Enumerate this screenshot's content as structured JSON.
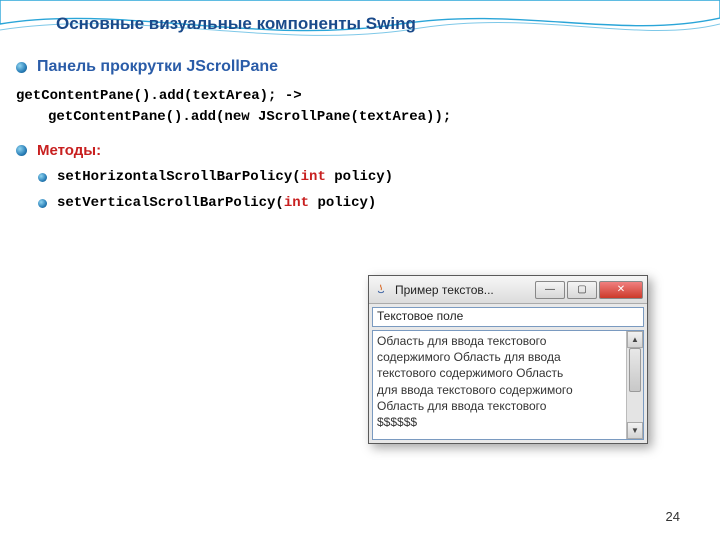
{
  "slide": {
    "title": "Основные визуальные компоненты Swing",
    "page_num": "24"
  },
  "section": {
    "heading": "Панель прокрутки JScrollPane"
  },
  "code": {
    "line1": "getContentPane().add(textArea); ->",
    "line2": "getContentPane().add(new JScrollPane(textArea));"
  },
  "methods": {
    "heading": "Методы:",
    "items": [
      {
        "pre": "setHorizontalScrollBarPolicy(",
        "kw": "int",
        "post": " policy)"
      },
      {
        "pre": "setVerticalScrollBarPolicy(",
        "kw": "int",
        "post": " policy)"
      }
    ]
  },
  "window": {
    "title": "Пример текстов...",
    "textfield_value": "Текстовое поле",
    "textarea_lines": [
      "Область для ввода текстового",
      "содержимого Область для ввода",
      "текстового содержимого Область",
      "для ввода текстового содержимого",
      "Область для ввода текстового",
      "$$$$$$"
    ]
  },
  "icons": {
    "min": "—",
    "max": "▢",
    "close": "✕",
    "up": "▲",
    "down": "▼"
  }
}
